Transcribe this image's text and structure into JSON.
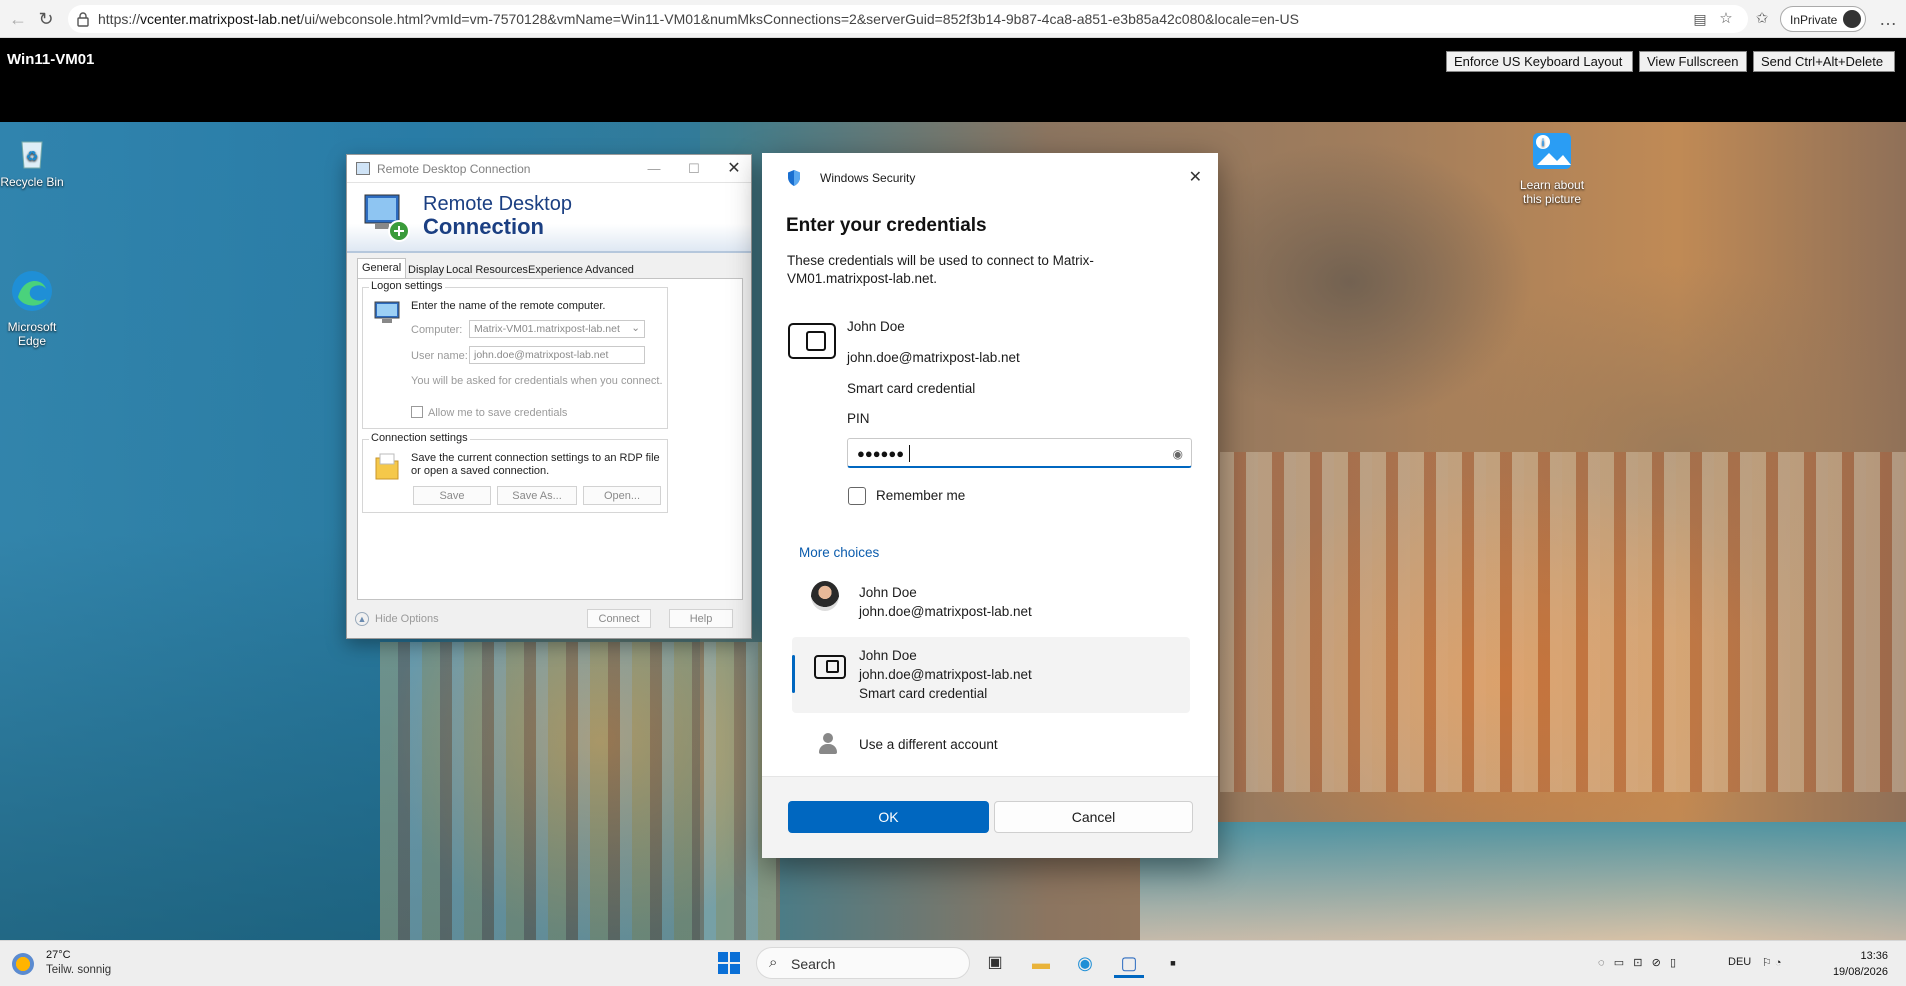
{
  "browser": {
    "url_prefix": "https://",
    "url_host": "vcenter.matrixpost-lab.net",
    "url_path": "/ui/webconsole.html?vmId=vm-7570128&vmName=Win11-VM01&numMksConnections=2&serverGuid=852f3b14-9b87-4ca8-a851-e3b85a42c080&locale=en-US",
    "inprivate_label": "InPrivate"
  },
  "vm_header": {
    "title": "Win11-VM01",
    "buttons": [
      "Enforce US Keyboard Layout",
      "View Fullscreen",
      "Send Ctrl+Alt+Delete"
    ]
  },
  "desktop_icons": {
    "recycle_bin": "Recycle Bin",
    "edge": "Microsoft Edge",
    "learn": "Learn about this picture"
  },
  "rdp": {
    "window_title": "Remote Desktop Connection",
    "banner_line1": "Remote Desktop",
    "banner_line2": "Connection",
    "tabs": [
      "General",
      "Display",
      "Local Resources",
      "Experience",
      "Advanced"
    ],
    "logon_group": "Logon settings",
    "logon_hint": "Enter the name of the remote computer.",
    "computer_label": "Computer:",
    "computer_value": "Matrix-VM01.matrixpost-lab.net",
    "username_label": "User name:",
    "username_value": "john.doe@matrixpost-lab.net",
    "ask_hint": "You will be asked for credentials when you connect.",
    "allow_save": "Allow me to save credentials",
    "conn_group": "Connection settings",
    "conn_hint": "Save the current connection settings to an RDP file or open a saved connection.",
    "save": "Save",
    "save_as": "Save As...",
    "open": "Open...",
    "hide_options": "Hide Options",
    "connect": "Connect",
    "help": "Help"
  },
  "security": {
    "header": "Windows Security",
    "title": "Enter your credentials",
    "description": "These credentials will be used to connect to Matrix-VM01.matrixpost-lab.net.",
    "user_name": "John Doe",
    "user_email": "john.doe@matrixpost-lab.net",
    "credential_type": "Smart card credential",
    "pin_label": "PIN",
    "pin_dots": "●●●●●●",
    "remember_me": "Remember me",
    "more_choices": "More choices",
    "accounts": [
      {
        "name": "John Doe",
        "email": "john.doe@matrixpost-lab.net"
      },
      {
        "name": "John Doe",
        "email": "john.doe@matrixpost-lab.net",
        "extra": "Smart card credential"
      },
      {
        "name": "Use a different account"
      }
    ],
    "ok": "OK",
    "cancel": "Cancel"
  },
  "taskbar": {
    "temp": "27°C",
    "weather": "Teilw. sonnig",
    "search": "Search",
    "lang": "DEU",
    "time": "13:36",
    "date": "19/08/2026"
  }
}
